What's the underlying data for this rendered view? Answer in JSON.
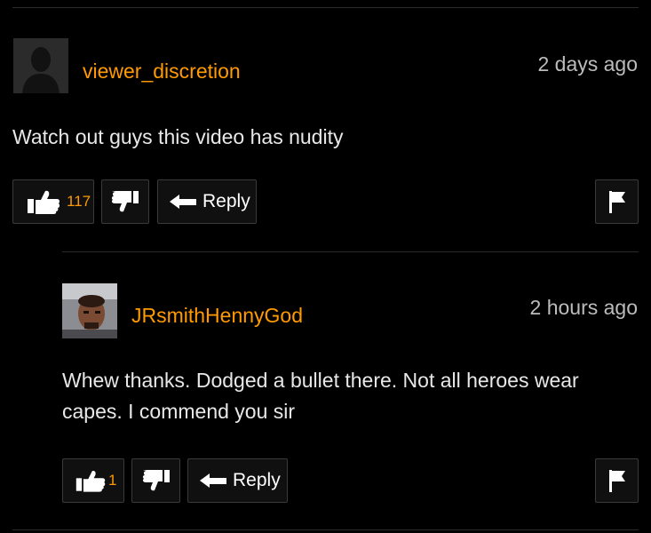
{
  "comments": [
    {
      "username": "viewer_discretion",
      "timestamp": "2 days ago",
      "text": "Watch out guys this video has nudity",
      "likes": "117",
      "reply_label": "Reply"
    },
    {
      "username": "JRsmithHennyGod",
      "timestamp": "2 hours ago",
      "text": "Whew thanks. Dodged a bullet there. Not all heroes wear capes. I commend you sir",
      "likes": "1",
      "reply_label": "Reply"
    }
  ],
  "icons": {
    "like": "thumbs-up-icon",
    "dislike": "thumbs-down-icon",
    "reply": "reply-arrow-icon",
    "flag": "flag-icon"
  },
  "colors": {
    "background": "#000000",
    "username": "#ff9a00",
    "like_count": "#ff9a00",
    "text": "#e8e8e8"
  }
}
